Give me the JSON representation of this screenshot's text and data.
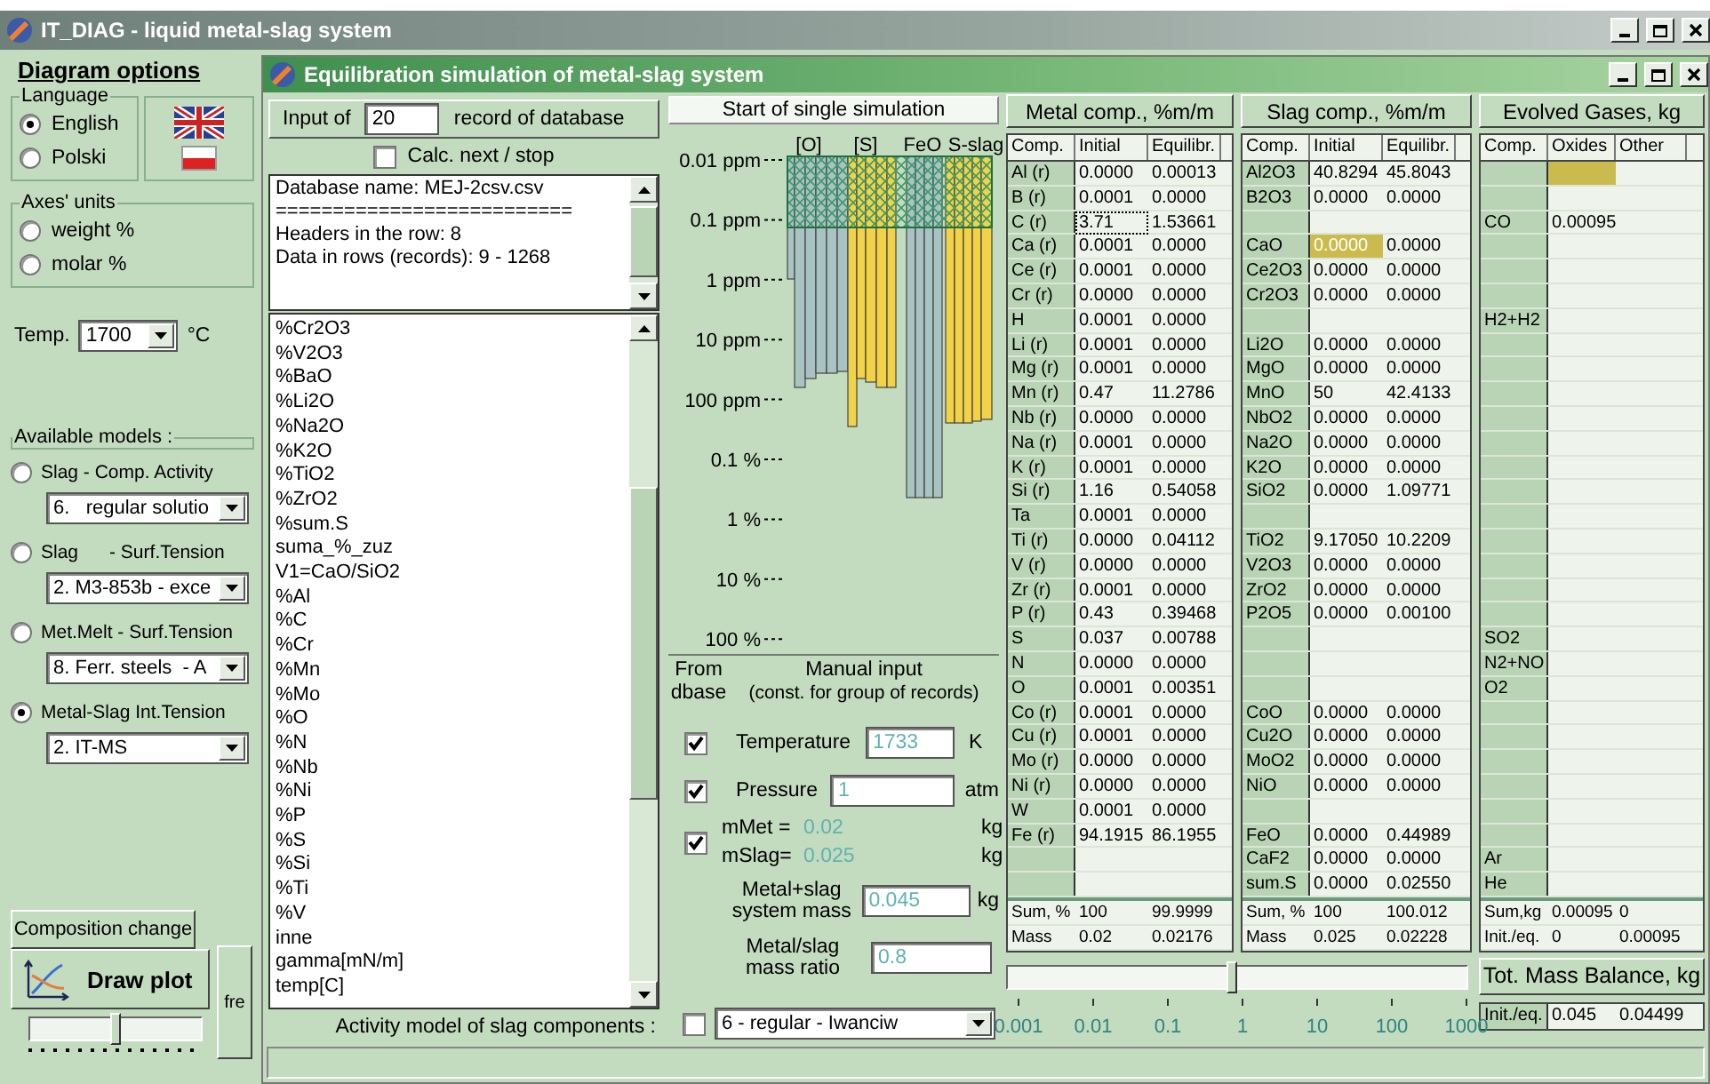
{
  "app": {
    "title": "IT_DIAG - liquid metal-slag system"
  },
  "options": {
    "title": "Diagram options",
    "language": {
      "label": "Language",
      "options": [
        {
          "label": "English",
          "selected": true
        },
        {
          "label": "Polski",
          "selected": false
        }
      ]
    },
    "axes_units": {
      "label": "Axes' units",
      "options": [
        {
          "label": "weight %",
          "selected": false
        },
        {
          "label": "molar %",
          "selected": false
        }
      ]
    },
    "temperature": {
      "label": "Temp.",
      "value": "1700",
      "unit": "°C"
    },
    "models": {
      "label": "Available models :",
      "items": [
        {
          "label": "Slag - Comp. Activity",
          "value": "6.   regular solutio",
          "selected": false
        },
        {
          "label": "Slag      - Surf.Tension",
          "value": "2. M3-853b - exce",
          "selected": false
        },
        {
          "label": "Met.Melt - Surf.Tension",
          "value": "8. Ferr. steels  - A",
          "selected": false
        },
        {
          "label": "Metal-Slag Int.Tension",
          "value": "2. IT-MS",
          "selected": true
        }
      ]
    },
    "composition_button": "Composition change",
    "draw_button": "Draw plot",
    "side_button": "fre",
    "slider": {
      "level": 0.5
    }
  },
  "sim": {
    "title": "Equilibration simulation of metal-slag system",
    "record": {
      "prefix": "Input of",
      "value": "20",
      "suffix": "record of database"
    },
    "calc_next": {
      "label": "Calc. next / stop",
      "checked": false
    },
    "info_lines": [
      "Database name: MEJ-2csv.csv",
      "==========================",
      "Headers in the row: 8",
      "Data in rows (records): 9 - 1268"
    ],
    "fields": [
      "%Cr2O3",
      "%V2O3",
      "%BaO",
      "%Li2O",
      "%Na2O",
      "%K2O",
      "%TiO2",
      "%ZrO2",
      "%sum.S",
      "suma_%_zuz",
      "V1=CaO/SiO2",
      "%Al",
      "%C",
      "%Cr",
      "%Mn",
      "%Mo",
      "%O",
      "%N",
      "%Nb",
      "%Ni",
      "%P",
      "%S",
      "%Si",
      "%Ti",
      "%V",
      "inne",
      "gamma[mN/m]",
      "temp[C]"
    ],
    "activity": {
      "label": "Activity model of slag components :",
      "checked": false,
      "value": "6 - regular - Iwanciw"
    },
    "start_button": "Start of single simulation",
    "chart": {
      "group_labels": [
        "[O]",
        "[S]",
        "FeO",
        "S-slag"
      ],
      "tick_labels": [
        "0.01 ppm",
        "0.1 ppm",
        "1 ppm",
        "10 ppm",
        "100 ppm",
        "0.1 %",
        "1 %",
        "10 %",
        "100 %"
      ]
    },
    "manual": {
      "from_label": "From dbase",
      "title": "Manual input",
      "note": "(const. for group of records)",
      "temperature": {
        "checked": true,
        "label": "Temperature",
        "value": "1733",
        "unit": "K"
      },
      "pressure": {
        "checked": true,
        "label": "Pressure",
        "value": "1",
        "unit": "atm"
      },
      "masses": {
        "checked": true,
        "met_label": "mMet =",
        "met_value": "0.02",
        "met_unit": "kg",
        "slag_label": "mSlag=",
        "slag_value": "0.025",
        "slag_unit": "kg"
      },
      "system_mass": {
        "label": "Metal+slag system mass",
        "value": "0.045",
        "unit": "kg"
      },
      "ratio": {
        "label": "Metal/slag mass ratio",
        "value": "0.8"
      }
    }
  },
  "metal": {
    "title": "Metal comp., %m/m",
    "columns": [
      "Comp.",
      "Initial",
      "Equilibr."
    ],
    "rows": [
      {
        "comp": "Al (r)",
        "initial": "0.0000",
        "equilibr": "0.00013",
        "selected": false
      },
      {
        "comp": "B (r)",
        "initial": "0.0001",
        "equilibr": "0.0000",
        "selected": false
      },
      {
        "comp": "C (r)",
        "initial": "3.71",
        "equilibr": "1.53661",
        "selected": true
      },
      {
        "comp": "Ca (r)",
        "initial": "0.0001",
        "equilibr": "0.0000",
        "selected": false
      },
      {
        "comp": "Ce (r)",
        "initial": "0.0001",
        "equilibr": "0.0000",
        "selected": false
      },
      {
        "comp": "Cr (r)",
        "initial": "0.0000",
        "equilibr": "0.0000",
        "selected": false
      },
      {
        "comp": "H",
        "initial": "0.0001",
        "equilibr": "0.0000",
        "selected": false
      },
      {
        "comp": "Li (r)",
        "initial": "0.0001",
        "equilibr": "0.0000",
        "selected": false
      },
      {
        "comp": "Mg (r)",
        "initial": "0.0001",
        "equilibr": "0.0000",
        "selected": false
      },
      {
        "comp": "Mn (r)",
        "initial": "0.47",
        "equilibr": "11.2786",
        "selected": false
      },
      {
        "comp": "Nb (r)",
        "initial": "0.0000",
        "equilibr": "0.0000",
        "selected": false
      },
      {
        "comp": "Na (r)",
        "initial": "0.0001",
        "equilibr": "0.0000",
        "selected": false
      },
      {
        "comp": "K (r)",
        "initial": "0.0001",
        "equilibr": "0.0000",
        "selected": false
      },
      {
        "comp": "Si (r)",
        "initial": "1.16",
        "equilibr": "0.54058",
        "selected": false
      },
      {
        "comp": "Ta",
        "initial": "0.0001",
        "equilibr": "0.0000",
        "selected": false
      },
      {
        "comp": "Ti (r)",
        "initial": "0.0000",
        "equilibr": "0.04112",
        "selected": false
      },
      {
        "comp": "V (r)",
        "initial": "0.0000",
        "equilibr": "0.0000",
        "selected": false
      },
      {
        "comp": "Zr (r)",
        "initial": "0.0001",
        "equilibr": "0.0000",
        "selected": false
      },
      {
        "comp": "P (r)",
        "initial": "0.43",
        "equilibr": "0.39468",
        "selected": false
      },
      {
        "comp": "S",
        "initial": "0.037",
        "equilibr": "0.00788",
        "selected": false
      },
      {
        "comp": "N",
        "initial": "0.0000",
        "equilibr": "0.0000",
        "selected": false
      },
      {
        "comp": "O",
        "initial": "0.0001",
        "equilibr": "0.00351",
        "selected": false
      },
      {
        "comp": "Co (r)",
        "initial": "0.0001",
        "equilibr": "0.0000",
        "selected": false
      },
      {
        "comp": "Cu (r)",
        "initial": "0.0001",
        "equilibr": "0.0000",
        "selected": false
      },
      {
        "comp": "Mo (r)",
        "initial": "0.0000",
        "equilibr": "0.0000",
        "selected": false
      },
      {
        "comp": "Ni (r)",
        "initial": "0.0000",
        "equilibr": "0.0000",
        "selected": false
      },
      {
        "comp": "W",
        "initial": "0.0001",
        "equilibr": "0.0000",
        "selected": false
      },
      {
        "comp": "Fe (r)",
        "initial": "94.1915",
        "equilibr": "86.1955",
        "selected": false
      }
    ],
    "totals": [
      {
        "label": "Sum, %",
        "initial": "100",
        "equilibr": "99.9999"
      },
      {
        "label": "Mass",
        "initial": "0.02",
        "equilibr": "0.02176"
      }
    ]
  },
  "slag": {
    "title": "Slag comp., %m/m",
    "columns": [
      "Comp.",
      "Initial",
      "Equilibr."
    ],
    "rows": [
      {
        "comp": "Al2O3",
        "initial": "40.8294",
        "equilibr": "45.8043",
        "selected": false
      },
      {
        "comp": "B2O3",
        "initial": "0.0000",
        "equilibr": "0.0000",
        "selected": false
      },
      {
        "selected": false
      },
      {
        "comp": "CaO",
        "initial": "0.0000",
        "equilibr": "0.0000",
        "selected": true
      },
      {
        "comp": "Ce2O3",
        "initial": "0.0000",
        "equilibr": "0.0000",
        "selected": false
      },
      {
        "comp": "Cr2O3",
        "initial": "0.0000",
        "equilibr": "0.0000",
        "selected": false
      },
      {
        "selected": false
      },
      {
        "comp": "Li2O",
        "initial": "0.0000",
        "equilibr": "0.0000",
        "selected": false
      },
      {
        "comp": "MgO",
        "initial": "0.0000",
        "equilibr": "0.0000",
        "selected": false
      },
      {
        "comp": "MnO",
        "initial": "50",
        "equilibr": "42.4133",
        "selected": false
      },
      {
        "comp": "NbO2",
        "initial": "0.0000",
        "equilibr": "0.0000",
        "selected": false
      },
      {
        "comp": "Na2O",
        "initial": "0.0000",
        "equilibr": "0.0000",
        "selected": false
      },
      {
        "comp": "K2O",
        "initial": "0.0000",
        "equilibr": "0.0000",
        "selected": false
      },
      {
        "comp": "SiO2",
        "initial": "0.0000",
        "equilibr": "1.09771",
        "selected": false
      },
      {
        "selected": false
      },
      {
        "comp": "TiO2",
        "initial": "9.17050",
        "equilibr": "10.2209",
        "selected": false
      },
      {
        "comp": "V2O3",
        "initial": "0.0000",
        "equilibr": "0.0000",
        "selected": false
      },
      {
        "comp": "ZrO2",
        "initial": "0.0000",
        "equilibr": "0.0000",
        "selected": false
      },
      {
        "comp": "P2O5",
        "initial": "0.0000",
        "equilibr": "0.00100",
        "selected": false
      },
      {
        "selected": false
      },
      {
        "selected": false
      },
      {
        "selected": false
      },
      {
        "comp": "CoO",
        "initial": "0.0000",
        "equilibr": "0.0000",
        "selected": false
      },
      {
        "comp": "Cu2O",
        "initial": "0.0000",
        "equilibr": "0.0000",
        "selected": false
      },
      {
        "comp": "MoO2",
        "initial": "0.0000",
        "equilibr": "0.0000",
        "selected": false
      },
      {
        "comp": "NiO",
        "initial": "0.0000",
        "equilibr": "0.0000",
        "selected": false
      },
      {
        "selected": false
      },
      {
        "comp": "FeO",
        "initial": "0.0000",
        "equilibr": "0.44989",
        "selected": false
      },
      {
        "comp": "CaF2",
        "initial": "0.0000",
        "equilibr": "0.0000",
        "selected": false
      },
      {
        "comp": "sum.S",
        "initial": "0.0000",
        "equilibr": "0.02550",
        "selected": false
      }
    ],
    "totals": [
      {
        "label": "Sum, %",
        "initial": "100",
        "equilibr": "100.012"
      },
      {
        "label": "Mass",
        "initial": "0.025",
        "equilibr": "0.02228"
      }
    ]
  },
  "gases": {
    "title": "Evolved Gases, kg",
    "columns": [
      "Comp.",
      "Oxides",
      "Other"
    ],
    "rows": [
      {
        "selected": true
      },
      {
        "selected": false
      },
      {
        "comp": "CO",
        "oxides": "0.00095",
        "selected": false
      },
      {
        "selected": false
      },
      {
        "selected": false
      },
      {
        "selected": false
      },
      {
        "comp": "H2+H2",
        "selected": false
      },
      {
        "selected": false
      },
      {
        "selected": false
      },
      {
        "selected": false
      },
      {
        "selected": false
      },
      {
        "selected": false
      },
      {
        "selected": false
      },
      {
        "selected": false
      },
      {
        "selected": false
      },
      {
        "selected": false
      },
      {
        "selected": false
      },
      {
        "selected": false
      },
      {
        "selected": false
      },
      {
        "comp": "SO2",
        "selected": false
      },
      {
        "comp": "N2+NO",
        "selected": false
      },
      {
        "comp": "O2",
        "selected": false
      },
      {
        "selected": false
      },
      {
        "selected": false
      },
      {
        "selected": false
      },
      {
        "selected": false
      },
      {
        "selected": false
      },
      {
        "selected": false
      },
      {
        "comp": "Ar",
        "selected": false
      },
      {
        "comp": "He",
        "selected": false
      }
    ],
    "totals": [
      {
        "label": "Sum,kg",
        "oxides": "0.00095",
        "other": "0"
      },
      {
        "label": "Init./eq.",
        "oxides": "0",
        "other": "0.00095"
      }
    ]
  },
  "balance": {
    "title": "Tot. Mass Balance, kg",
    "label": "Init./eq.",
    "values": [
      "0.045",
      "0.04499"
    ]
  },
  "scale": {
    "level": 0.49,
    "labels": [
      "0.001",
      "0.01",
      "0.1",
      "1",
      "10",
      "100",
      "1000"
    ]
  }
}
